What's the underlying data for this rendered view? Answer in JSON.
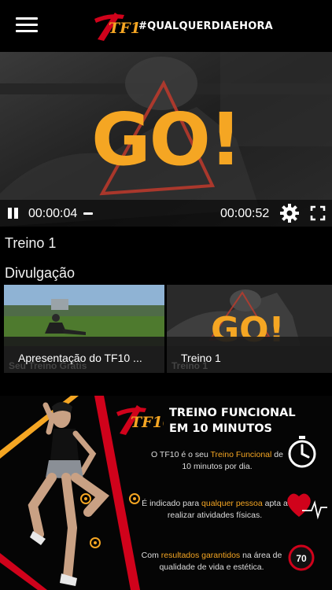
{
  "header": {
    "logo_text": "TF10'",
    "hashtag": "#QUALQUERDIAEHORA"
  },
  "player": {
    "overlay_text": "GO!",
    "current_time": "00:00:04",
    "total_time": "00:00:52",
    "progress": 0.08
  },
  "video_title": "Treino 1",
  "section": {
    "title": "Divulgação",
    "items": [
      {
        "label": "Apresentação do TF10 ...",
        "ghost_text": "Seu Treino Grátis"
      },
      {
        "label": "Treino 1",
        "ghost_text": "Treino 1",
        "overlay_text": "GO!"
      }
    ]
  },
  "banner": {
    "logo_text": "TF10'",
    "title_line1": "TREINO FUNCIONAL",
    "title_line2": "EM 10 MINUTOS",
    "p1_a": "O TF10 é o seu ",
    "p1_highlight": "Treino Funcional",
    "p1_b": " de 10 minutos por dia.",
    "p2_a": "É indicado para ",
    "p2_highlight": "qualquer pessoa",
    "p2_b": " apta a realizar atividades físicas.",
    "p3_a": "Com ",
    "p3_highlight": "resultados garantidos",
    "p3_b": " na área de qualidade de vida e estética.",
    "badge_number": "70"
  },
  "colors": {
    "accent": "#f5a623",
    "red": "#d0021b",
    "background": "#000000"
  }
}
